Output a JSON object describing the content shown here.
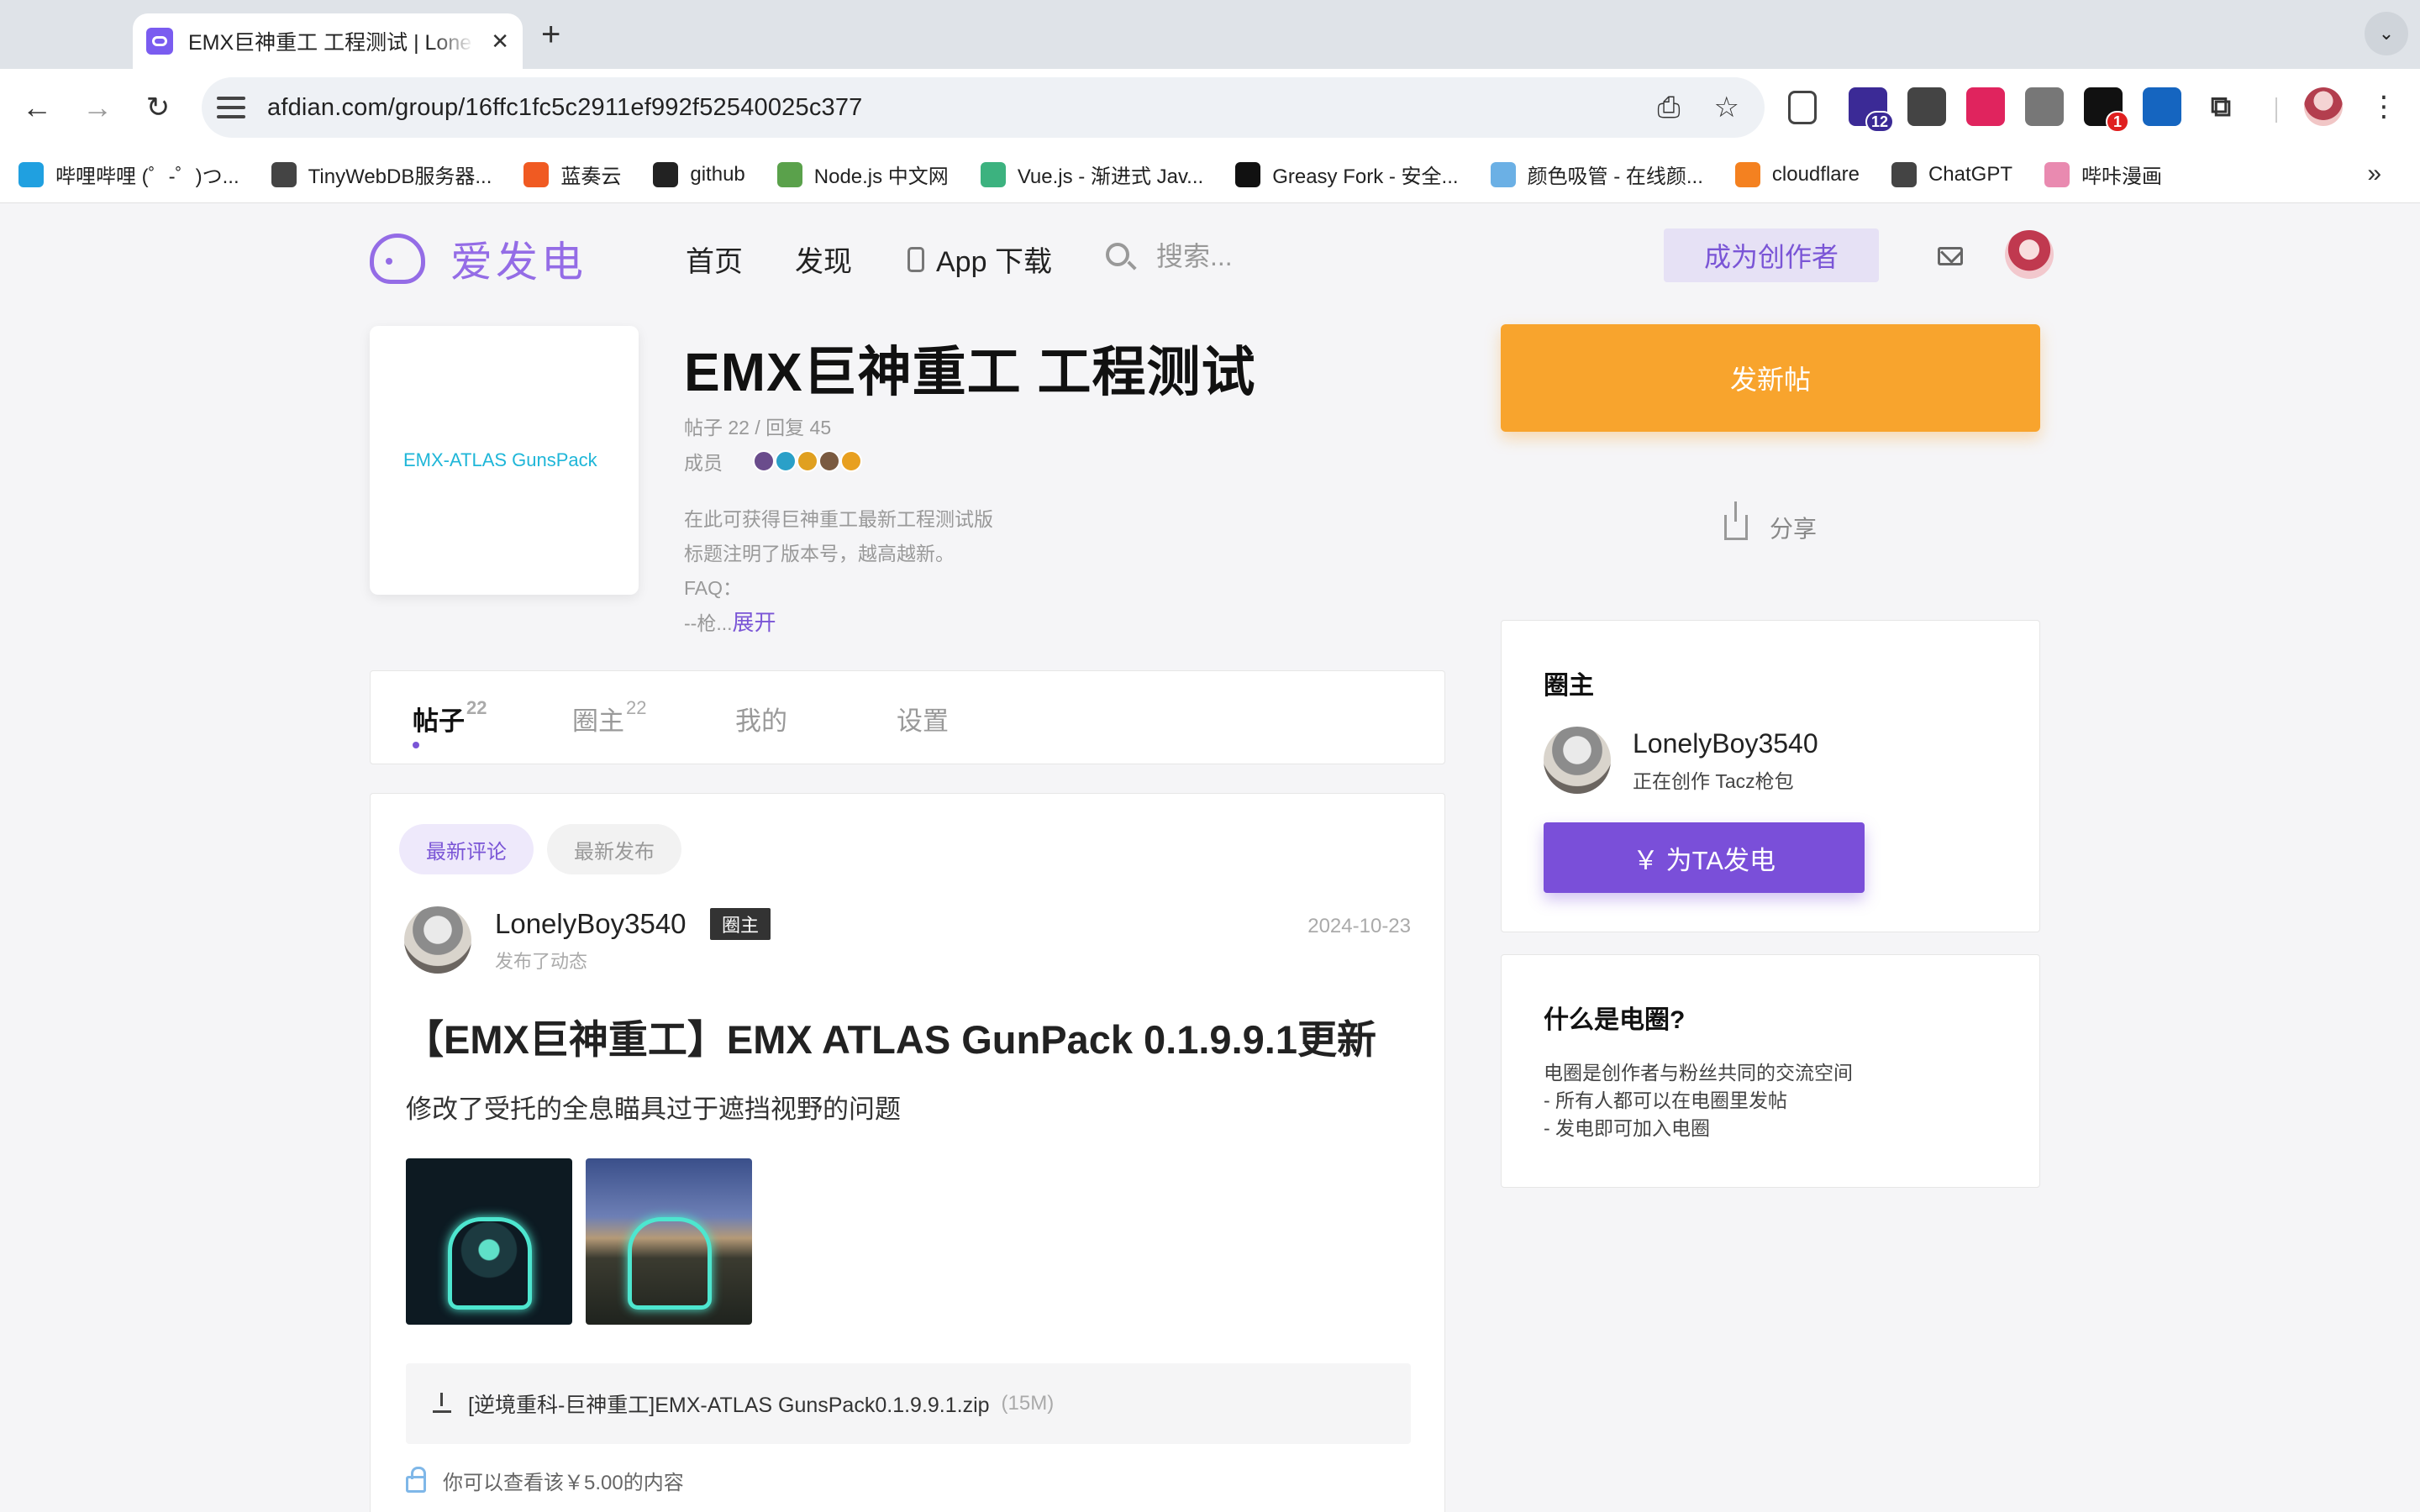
{
  "browser": {
    "tab_title": "EMX巨神重工 工程测试 | Lone",
    "tab_close": "✕",
    "new_tab": "+",
    "tab_menu": "⌄",
    "url": "afdian.com/group/16ffc1fc5c2911ef992f52540025c377",
    "extensions": [
      {
        "name": "ext-graduation",
        "badge": "12",
        "color": "#3b2a96"
      },
      {
        "name": "ext-qr",
        "badge": "",
        "color": "#444444"
      },
      {
        "name": "ext-translate",
        "badge": "",
        "color": "#e0245e"
      },
      {
        "name": "ext-vue-devtools",
        "badge": "",
        "color": "#777777"
      },
      {
        "name": "ext-notify",
        "badge": "1",
        "color": "#111111"
      },
      {
        "name": "ext-switch",
        "badge": "",
        "color": "#1565c0"
      }
    ],
    "bookmarks": [
      {
        "label": "哔哩哔哩 (゜-゜)つ...",
        "color": "#20a0e0"
      },
      {
        "label": "TinyWebDB服务器...",
        "color": "#444444"
      },
      {
        "label": "蓝奏云",
        "color": "#f05a22"
      },
      {
        "label": "github",
        "color": "#222222"
      },
      {
        "label": "Node.js 中文网",
        "color": "#5aa14b"
      },
      {
        "label": "Vue.js - 渐进式 Jav...",
        "color": "#3cb27f"
      },
      {
        "label": "Greasy Fork - 安全...",
        "color": "#111111"
      },
      {
        "label": "颜色吸管 - 在线颜...",
        "color": "#6bb0e5"
      },
      {
        "label": "cloudflare",
        "color": "#f48120"
      },
      {
        "label": "ChatGPT",
        "color": "#444444"
      },
      {
        "label": "哔咔漫画",
        "color": "#e98ab0"
      }
    ],
    "bookmarks_more": "»"
  },
  "site": {
    "logo_text": "爱发电",
    "nav": {
      "home": "首页",
      "discover": "发现",
      "app": "App 下载"
    },
    "search_placeholder": "搜索...",
    "become_creator": "成为创作者"
  },
  "group": {
    "cover_text": "EMX-ATLAS GunsPack",
    "title": "EMX巨神重工 工程测试",
    "stats": "帖子 22 / 回复 45",
    "members_label": "成员",
    "member_colors": [
      "#6a4c8c",
      "#2aa0c8",
      "#e0a020",
      "#7a5a40",
      "#e8a020"
    ],
    "desc_lines": [
      "在此可获得巨神重工最新工程测试版",
      "标题注明了版本号，越高越新。",
      "FAQ："
    ],
    "desc_truncated": "--枪...",
    "expand": "展开",
    "new_post": "发新帖",
    "share": "分享"
  },
  "tabs": [
    {
      "label": "帖子",
      "count": "22"
    },
    {
      "label": "圈主",
      "count": "22"
    },
    {
      "label": "我的",
      "count": ""
    },
    {
      "label": "设置",
      "count": ""
    }
  ],
  "feed": {
    "filters": {
      "latest_comment": "最新评论",
      "latest_post": "最新发布"
    },
    "post": {
      "author": "LonelyBoy3540",
      "badge": "圈主",
      "sub": "发布了动态",
      "date": "2024-10-23",
      "title": "【EMX巨神重工】EMX ATLAS GunPack 0.1.9.9.1更新",
      "body": "修改了受托的全息瞄具过于遮挡视野的问题",
      "attachment_name": "[逆境重科-巨神重工]EMX-ATLAS GunsPack0.1.9.9.1.zip",
      "attachment_size": "(15M)",
      "locked_text": "你可以查看该￥5.00的内容"
    }
  },
  "owner_card": {
    "heading": "圈主",
    "name": "LonelyBoy3540",
    "status": "正在创作 Tacz枪包",
    "sponsor_button": "￥  为TA发电"
  },
  "what_card": {
    "heading": "什么是电圈?",
    "lines": [
      "电圈是创作者与粉丝共同的交流空间",
      "- 所有人都可以在电圈里发帖",
      "- 发电即可加入电圈"
    ]
  }
}
